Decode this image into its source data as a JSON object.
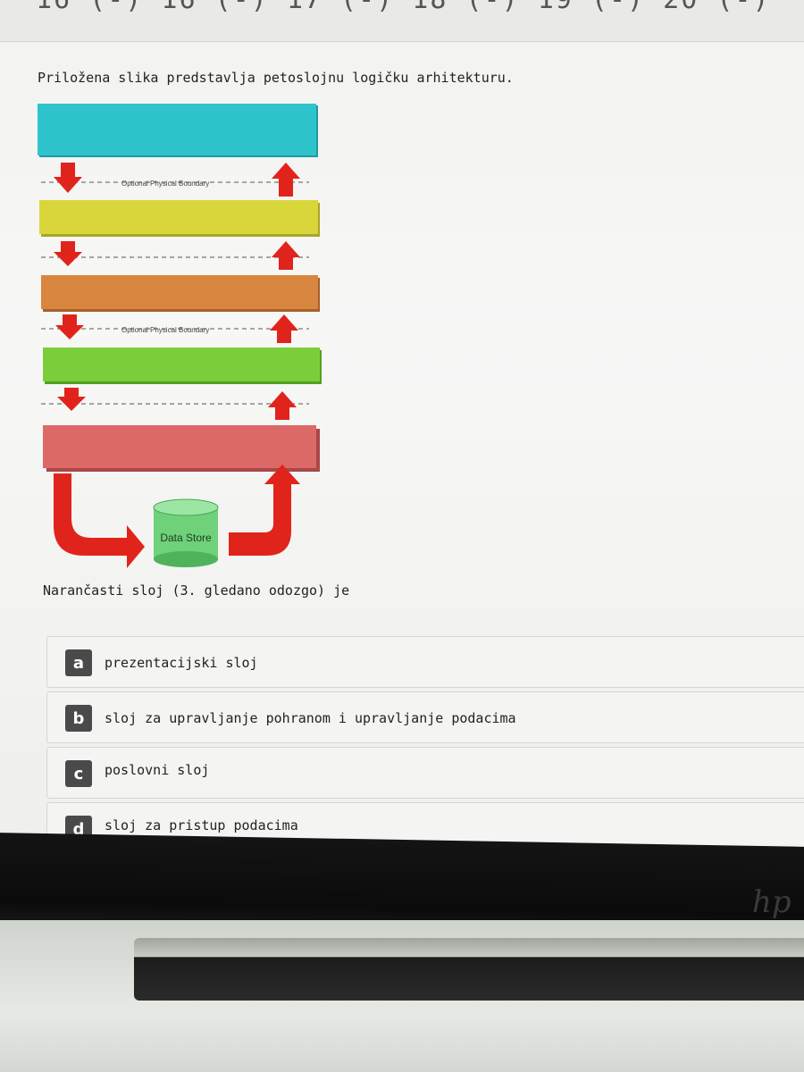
{
  "header": {
    "question_nav": "16 (-)  16 (-)  17 (-)  18 (-)  19 (-)  20 (-)"
  },
  "question": {
    "intro": "Priložena slika predstavlja petoslojnu logičku arhitekturu.",
    "prompt": "Narančasti sloj (3. gledano odozgo) je"
  },
  "diagram": {
    "boundary_label": "Optional Physical Boundary",
    "datastore_label": "Data Store",
    "layer_colors": [
      "#2fc4cc",
      "#d8d63a",
      "#d98640",
      "#7ccd3a",
      "#dd6868"
    ],
    "arrow_color": "#e0241c",
    "datastore_color": "#6fd17a"
  },
  "options": [
    {
      "letter": "a",
      "label": "prezentacijski sloj"
    },
    {
      "letter": "b",
      "label": "sloj za upravljanje pohranom i upravljanje podacima"
    },
    {
      "letter": "c",
      "label": "poslovni sloj"
    },
    {
      "letter": "d",
      "label": "sloj za pristup podacima"
    }
  ],
  "device": {
    "brand_logo": "hp"
  }
}
